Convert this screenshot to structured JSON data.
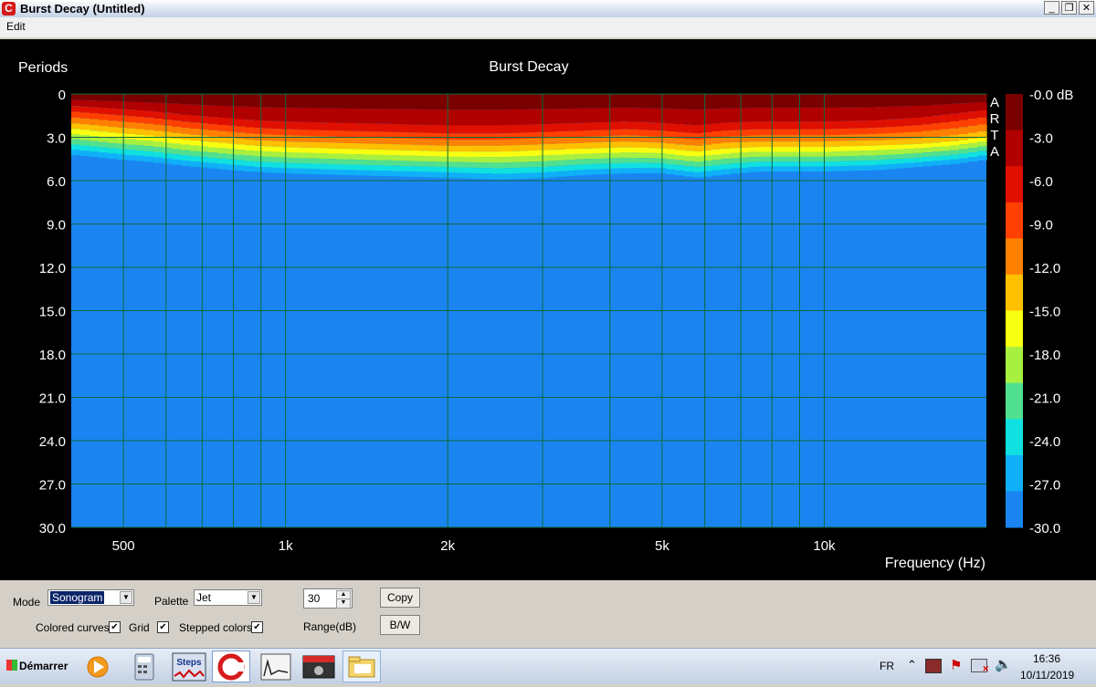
{
  "window": {
    "title": "Burst Decay  (Untitled)",
    "app_icon": "arta-logo-icon",
    "controls": [
      "minimize",
      "restore",
      "close"
    ]
  },
  "menu": {
    "edit": "Edit"
  },
  "chart_data": {
    "type": "heatmap",
    "title": "Burst Decay",
    "ylabel": "Periods",
    "xlabel": "Frequency (Hz)",
    "x_scale": "log",
    "xlim": [
      400,
      20000
    ],
    "ylim": [
      0,
      30
    ],
    "x_ticks": [
      {
        "value": 500,
        "label": "500"
      },
      {
        "value": 1000,
        "label": "1k"
      },
      {
        "value": 2000,
        "label": "2k"
      },
      {
        "value": 5000,
        "label": "5k"
      },
      {
        "value": 10000,
        "label": "10k"
      }
    ],
    "y_ticks": [
      {
        "value": 0,
        "label": "0"
      },
      {
        "value": 3,
        "label": "3.0"
      },
      {
        "value": 6,
        "label": "6.0"
      },
      {
        "value": 9,
        "label": "9.0"
      },
      {
        "value": 12,
        "label": "12.0"
      },
      {
        "value": 15,
        "label": "15.0"
      },
      {
        "value": 18,
        "label": "18.0"
      },
      {
        "value": 21,
        "label": "21.0"
      },
      {
        "value": 24,
        "label": "24.0"
      },
      {
        "value": 27,
        "label": "27.0"
      },
      {
        "value": 30,
        "label": "30.0"
      }
    ],
    "grid": true,
    "watermark": "ARTA",
    "colorbar": {
      "labels": [
        "-0.0 dB",
        "-3.0",
        "-6.0",
        "-9.0",
        "-12.0",
        "-15.0",
        "-18.0",
        "-21.0",
        "-24.0",
        "-27.0",
        "-30.0"
      ],
      "levels": [
        0,
        -3,
        -6,
        -9,
        -12,
        -15,
        -18,
        -21,
        -24,
        -27,
        -30
      ],
      "colors": [
        "#7a0000",
        "#b00000",
        "#e01000",
        "#ff4000",
        "#ff8000",
        "#ffc000",
        "#f8ff10",
        "#a8f040",
        "#50e090",
        "#10e0e0",
        "#10b0f8",
        "#1a85f0"
      ]
    },
    "decay_profile": {
      "freq_hz": [
        400,
        480,
        560,
        660,
        760,
        880,
        1000,
        1250,
        1600,
        2000,
        2500,
        3000,
        3600,
        4300,
        5000,
        5800,
        6500,
        7500,
        8700,
        10000,
        12500,
        15000,
        17500,
        20000
      ],
      "periods_to_minus_27db": [
        3.8,
        4.1,
        4.3,
        4.6,
        4.8,
        5.0,
        5.1,
        5.2,
        5.3,
        5.4,
        5.5,
        5.4,
        5.2,
        5.1,
        5.1,
        5.4,
        5.2,
        5.0,
        5.0,
        5.0,
        4.9,
        4.7,
        4.5,
        4.2
      ],
      "periods_to_minus_15db": [
        2.2,
        2.5,
        2.7,
        3.0,
        3.2,
        3.4,
        3.5,
        3.6,
        3.7,
        3.8,
        3.8,
        3.7,
        3.6,
        3.5,
        3.6,
        3.8,
        3.6,
        3.5,
        3.5,
        3.5,
        3.4,
        3.3,
        3.1,
        2.8
      ],
      "periods_to_minus_6db": [
        0.9,
        1.1,
        1.3,
        1.6,
        1.8,
        2.0,
        2.1,
        2.2,
        2.3,
        2.4,
        2.4,
        2.3,
        2.2,
        2.1,
        2.2,
        2.4,
        2.2,
        2.1,
        2.1,
        2.1,
        2.0,
        1.8,
        1.5,
        1.2
      ]
    }
  },
  "controls": {
    "mode_label": "Mode",
    "mode_value": "Sonogram",
    "palette_label": "Palette",
    "palette_value": "Jet",
    "range_value": "30",
    "range_label": "Range(dB)",
    "copy_button": "Copy",
    "bw_button": "B/W",
    "colored_curves_label": "Colored curves",
    "colored_curves_checked": true,
    "grid_label": "Grid",
    "grid_checked": true,
    "stepped_colors_label": "Stepped colors",
    "stepped_colors_checked": true
  },
  "taskbar": {
    "start_label": "Démarrer",
    "apps": [
      {
        "name": "media-player-icon"
      },
      {
        "name": "calculator-icon"
      },
      {
        "name": "steps-icon",
        "text": "Steps"
      },
      {
        "name": "arta-icon"
      },
      {
        "name": "limp-icon"
      },
      {
        "name": "video-icon"
      },
      {
        "name": "explorer-icon"
      }
    ],
    "lang": "FR",
    "time": "16:36",
    "date": "10/11/2019"
  }
}
